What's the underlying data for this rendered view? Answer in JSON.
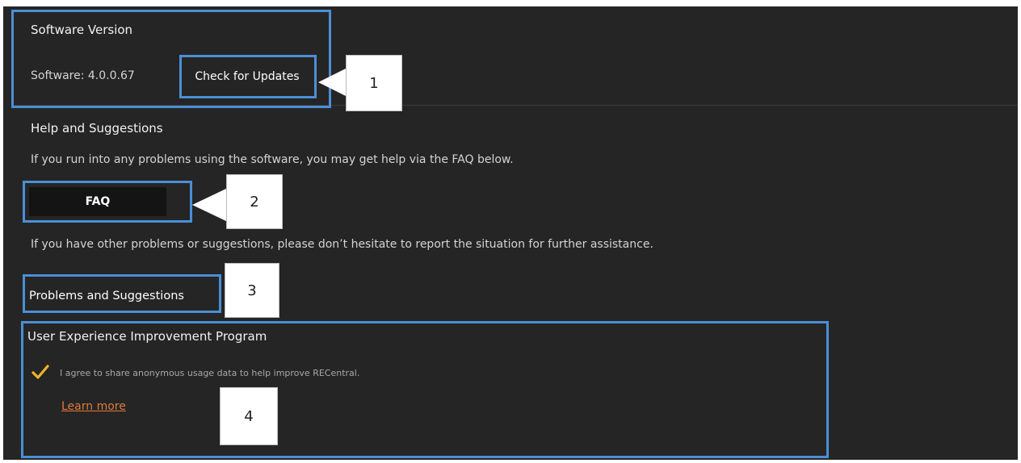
{
  "software_version": {
    "heading": "Software Version",
    "software_label": "Software: 4.0.0.67",
    "check_updates_label": "Check for Updates"
  },
  "help": {
    "heading": "Help and Suggestions",
    "faq_description": "If you run into any problems using the software, you may get help via the FAQ below.",
    "faq_label": "FAQ",
    "report_description": "If you have other problems or suggestions, please don’t hesitate to report the situation for further assistance.",
    "report_label": "Problems and Suggestions"
  },
  "uxip": {
    "heading": "User Experience Improvement Program",
    "agree_text": "I agree to share anonymous usage data to help improve RECentral.",
    "checked": true,
    "learn_more_label": "Learn more"
  },
  "callouts": [
    "1",
    "2",
    "3",
    "4"
  ],
  "colors": {
    "panel_bg": "#252525",
    "highlight": "#4a8fd6",
    "link": "#e07a3a",
    "checkmark": "#f0b429"
  }
}
